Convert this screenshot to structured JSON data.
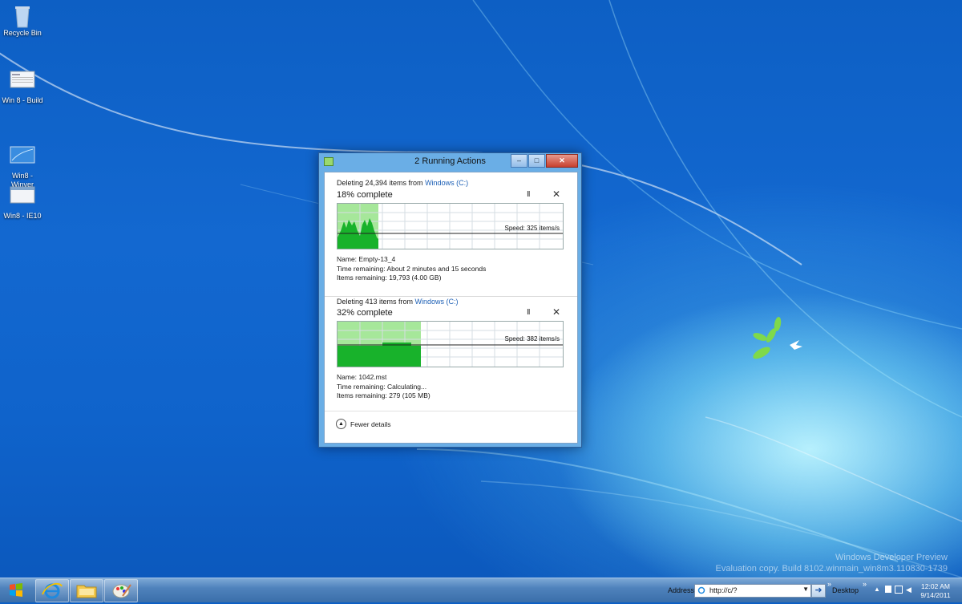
{
  "desktop": {
    "icons": [
      {
        "label": "Recycle Bin",
        "icon": "recycle-bin-icon"
      },
      {
        "label": "Win 8 - Build",
        "icon": "document-shortcut-icon"
      },
      {
        "label": "Win8 -\nWinver",
        "icon": "winver-shortcut-icon"
      },
      {
        "label": "Win8 - IE10",
        "icon": "window-shortcut-icon"
      }
    ],
    "watermark_line1": "Windows Developer Preview",
    "watermark_line2": "Evaluation copy. Build 8102.winmain_win8m3.110830-1739"
  },
  "dialog": {
    "title": "2 Running Actions",
    "minimize_glyph": "–",
    "maximize_glyph": "□",
    "close_glyph": "✕",
    "operations": [
      {
        "action_prefix": "Deleting 24,394 items from ",
        "source": "Windows (C:)",
        "percent_label": "18% complete",
        "progress": 0.18,
        "speed_label": "Speed: 325 items/s",
        "name": "Name:  Empty-13_4",
        "time_remaining": "Time remaining:  About 2 minutes and 15 seconds",
        "items_remaining": "Items remaining:  19,793 (4.00 GB)"
      },
      {
        "action_prefix": "Deleting 413 items from ",
        "source": "Windows (C:)",
        "percent_label": "32% complete",
        "progress": 0.32,
        "speed_label": "Speed: 382 items/s",
        "name": "Name:  1042.mst",
        "time_remaining": "Time remaining:  Calculating...",
        "items_remaining": "Items remaining:  279 (105 MB)"
      }
    ],
    "pause_glyph": "II",
    "cancel_glyph": "✕",
    "fewer_details": "Fewer details"
  },
  "taskbar": {
    "pinned": [
      "internet-explorer-icon",
      "file-explorer-icon",
      "paint-icon"
    ],
    "address_label": "Address",
    "address_value": "http://c/?",
    "go_glyph": "➜",
    "desktop_label": "Desktop",
    "time": "12:02 AM",
    "date": "9/14/2011"
  },
  "colors": {
    "graph_fill_light": "#a6e79a",
    "graph_fill_dark": "#18b22b",
    "accent_link": "#1c5fb5"
  }
}
